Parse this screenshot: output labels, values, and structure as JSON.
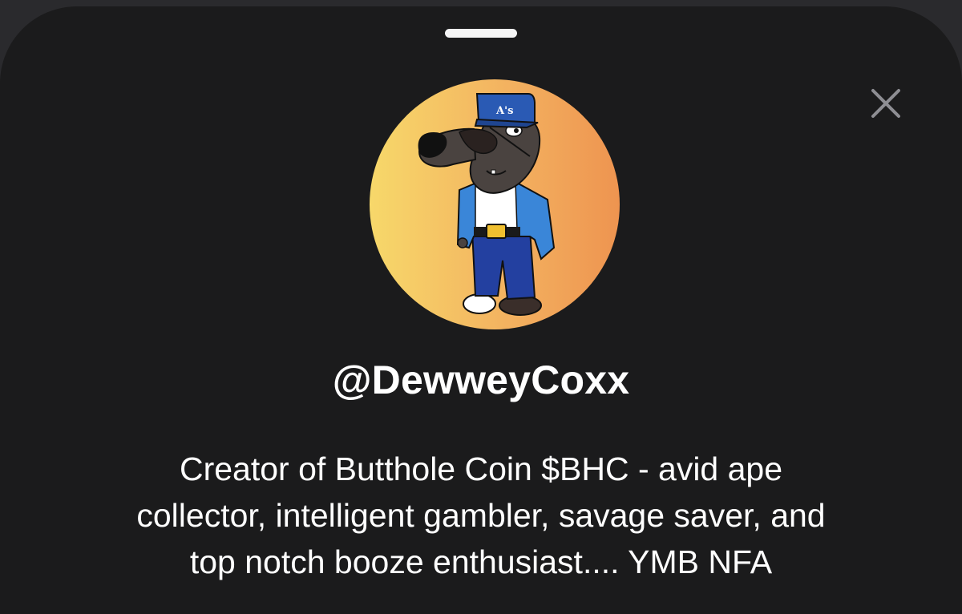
{
  "profile": {
    "handle": "@DewweyCoxx",
    "bio_lines": [
      "Creator of Butthole Coin $BHC - avid ape",
      "collector, intelligent gambler, savage saver, and",
      "top notch booze enthusiast.... YMB NFA"
    ],
    "avatar": {
      "cap_text": "A's",
      "gradient": [
        "#f7d86a",
        "#ee9450"
      ]
    }
  },
  "icons": {
    "close": "close-icon",
    "grabber": "sheet-grabber"
  },
  "colors": {
    "sheet_background": "#1b1b1c",
    "backdrop": "#2a2a2d",
    "text": "#ffffff",
    "close_icon": "#8e8e93"
  }
}
